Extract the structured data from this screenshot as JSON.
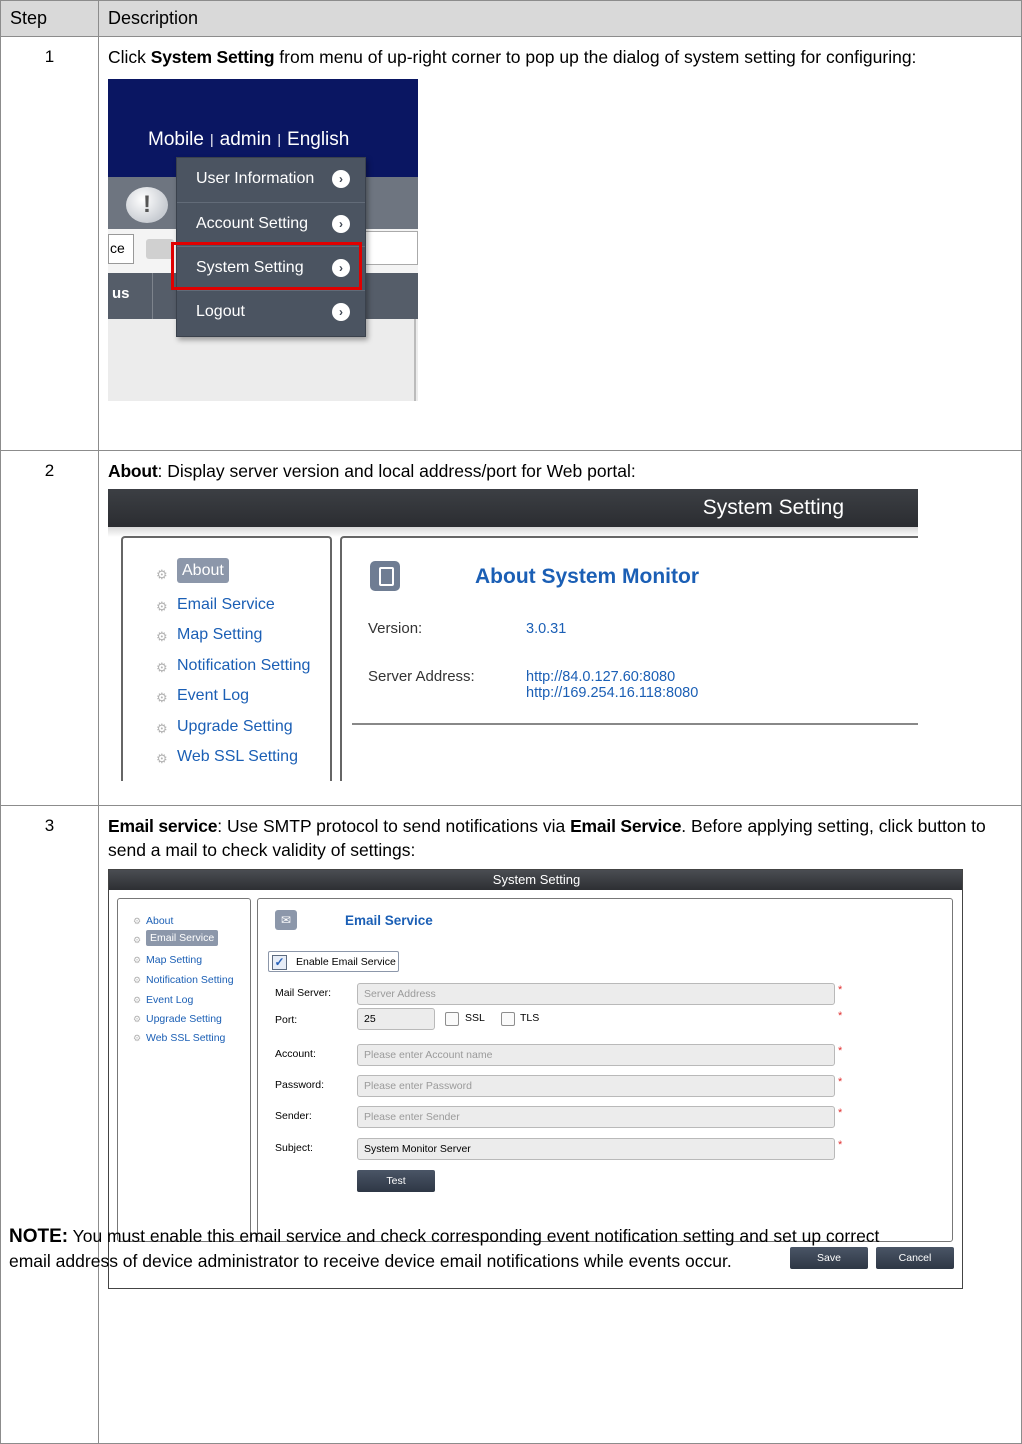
{
  "table": {
    "headers": {
      "step": "Step",
      "description": "Description"
    },
    "steps": [
      {
        "number": "1"
      },
      {
        "number": "2"
      },
      {
        "number": "3"
      }
    ]
  },
  "step1": {
    "text_before": "Click ",
    "bold": "System Setting",
    "text_after": " from menu of up-right corner to pop up the dialog of system setting for configuring:",
    "screenshot": {
      "topnav": {
        "mobile": "Mobile",
        "sep1": "|",
        "admin": "admin",
        "sep2": "|",
        "language": "English"
      },
      "left_fragments": {
        "ce": "ce",
        "us": "us"
      },
      "alert_glyph": "!",
      "menu": [
        {
          "label": "User Information",
          "arrow": "›"
        },
        {
          "label": "Account Setting",
          "arrow": "›"
        },
        {
          "label": "System Setting",
          "arrow": "›"
        },
        {
          "label": "Logout",
          "arrow": "›"
        }
      ],
      "highlight_color": "#e00000"
    }
  },
  "step2": {
    "bold": "About",
    "text_after": ": Display server version and local address/port for Web portal:",
    "screenshot": {
      "window_title": "System Setting",
      "nav": [
        {
          "label": "About",
          "selected": true
        },
        {
          "label": "Email Service"
        },
        {
          "label": "Map Setting"
        },
        {
          "label": "Notification Setting"
        },
        {
          "label": "Event Log"
        },
        {
          "label": "Upgrade Setting"
        },
        {
          "label": "Web SSL Setting"
        }
      ],
      "heading": "About System Monitor",
      "version_label": "Version:",
      "version_value": "3.0.31",
      "server_label": "Server Address:",
      "server_value_1": "http://84.0.127.60:8080",
      "server_value_2": "http://169.254.16.118:8080"
    }
  },
  "step3": {
    "bold1": "Email service",
    "text_mid": ": Use SMTP protocol to send notifications via ",
    "bold2": "Email Service",
    "text_after": ". Before applying setting, click button to send a mail to check validity of settings:",
    "screenshot": {
      "window_title": "System Setting",
      "nav": [
        {
          "label": "About"
        },
        {
          "label": "Email Service",
          "selected": true
        },
        {
          "label": "Map Setting"
        },
        {
          "label": "Notification Setting"
        },
        {
          "label": "Event Log"
        },
        {
          "label": "Upgrade Setting"
        },
        {
          "label": "Web SSL Setting"
        }
      ],
      "heading": "Email Service",
      "enable_label": "Enable Email Service",
      "enable_checked": true,
      "fields": {
        "mail_server": {
          "label": "Mail Server:",
          "placeholder": "Server Address"
        },
        "port": {
          "label": "Port:",
          "value": "25",
          "ssl": "SSL",
          "tls": "TLS"
        },
        "account": {
          "label": "Account:",
          "placeholder": "Please enter Account name"
        },
        "password": {
          "label": "Password:",
          "placeholder": "Please enter Password"
        },
        "sender": {
          "label": "Sender:",
          "placeholder": "Please enter Sender"
        },
        "subject": {
          "label": "Subject:",
          "value": "System Monitor Server"
        }
      },
      "required_mark": "*",
      "buttons": {
        "test": "Test",
        "save": "Save",
        "cancel": "Cancel"
      }
    },
    "note_lead": "NOTE:",
    "note_text": " You must enable this email service and check corresponding event notification setting and set up correct email address of device administrator to receive device email notifications while events occur."
  }
}
